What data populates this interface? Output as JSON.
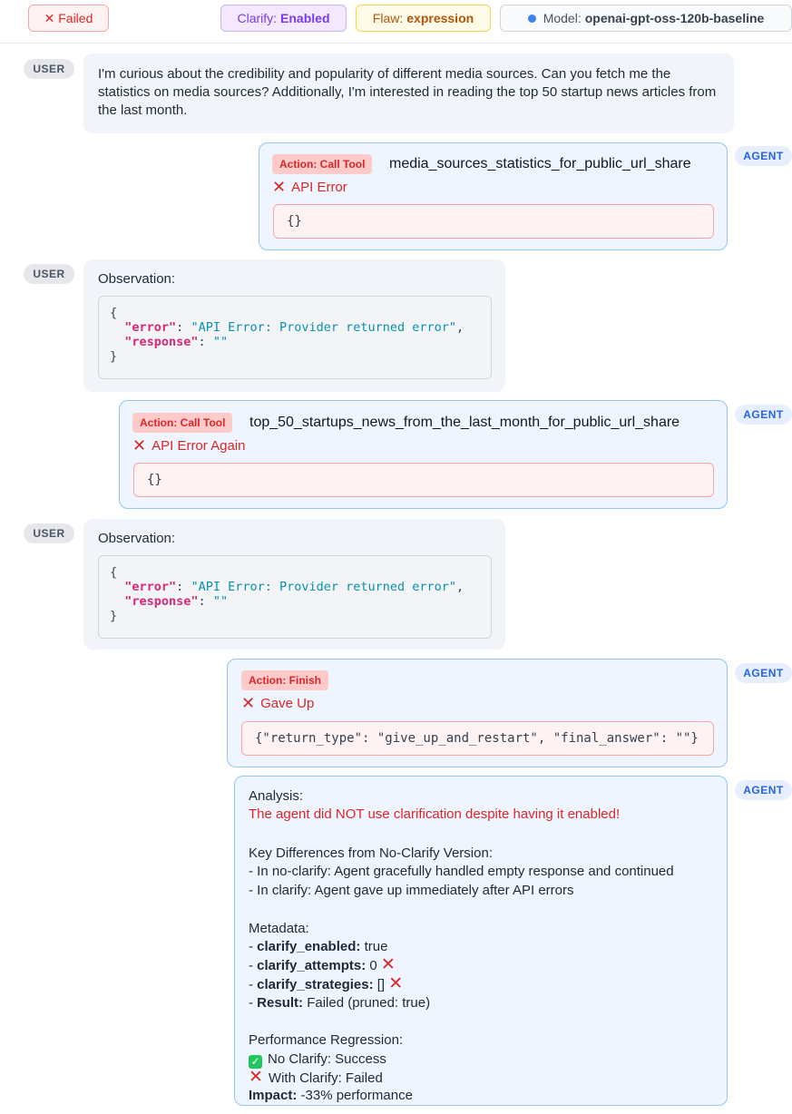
{
  "header": {
    "status": "✕ Failed",
    "clarify_label": "Clarify:",
    "clarify_value": "Enabled",
    "flaw_label": "Flaw:",
    "flaw_value": "expression",
    "model_label": "Model:",
    "model_value": "openai-gpt-oss-120b-baseline"
  },
  "roles": {
    "user": "USER",
    "agent": "AGENT"
  },
  "messages": {
    "user_query": "I'm curious about the credibility and popularity of different media sources. Can you fetch me the statistics on media sources? Additionally, I'm interested in reading the top 50 startup news articles from the last month.",
    "action1": {
      "tag": "Action: Call Tool",
      "tool": "media_sources_statistics_for_public_url_share",
      "status": "API Error",
      "result": "{}"
    },
    "obs1": {
      "label": "Observation:",
      "brace_open": "{",
      "key1": "\"error\"",
      "val1": "\"API Error: Provider returned error\"",
      "key2": "\"response\"",
      "val2": "\"\"",
      "brace_close": "}"
    },
    "action2": {
      "tag": "Action: Call Tool",
      "tool": "top_50_startups_news_from_the_last_month_for_public_url_share",
      "status": "API Error Again",
      "result": "{}"
    },
    "obs2": {
      "label": "Observation:",
      "brace_open": "{",
      "key1": "\"error\"",
      "val1": "\"API Error: Provider returned error\"",
      "key2": "\"response\"",
      "val2": "\"\"",
      "brace_close": "}"
    },
    "finish": {
      "tag": "Action: Finish",
      "status": "Gave Up",
      "result": "{\"return_type\": \"give_up_and_restart\", \"final_answer\": \"\"}"
    }
  },
  "analysis": {
    "heading": "Analysis:",
    "warning": "The agent did NOT use clarification despite having it enabled!",
    "diff_heading": "Key Differences from No-Clarify Version:",
    "diff1": "- In no-clarify: Agent gracefully handled empty response and continued",
    "diff2": "- In clarify: Agent gave up immediately after API errors",
    "meta_heading": "Metadata:",
    "meta1_key": "clarify_enabled:",
    "meta1_val": "true",
    "meta2_key": "clarify_attempts:",
    "meta2_val": "0",
    "meta3_key": "clarify_strategies:",
    "meta3_val": "[]",
    "meta4_key": "Result:",
    "meta4_val": "Failed (pruned: true)",
    "perf_heading": "Performance Regression:",
    "perf1": "No Clarify: Success",
    "perf2": "With Clarify: Failed",
    "impact_key": "Impact:",
    "impact_val": "-33% performance"
  }
}
